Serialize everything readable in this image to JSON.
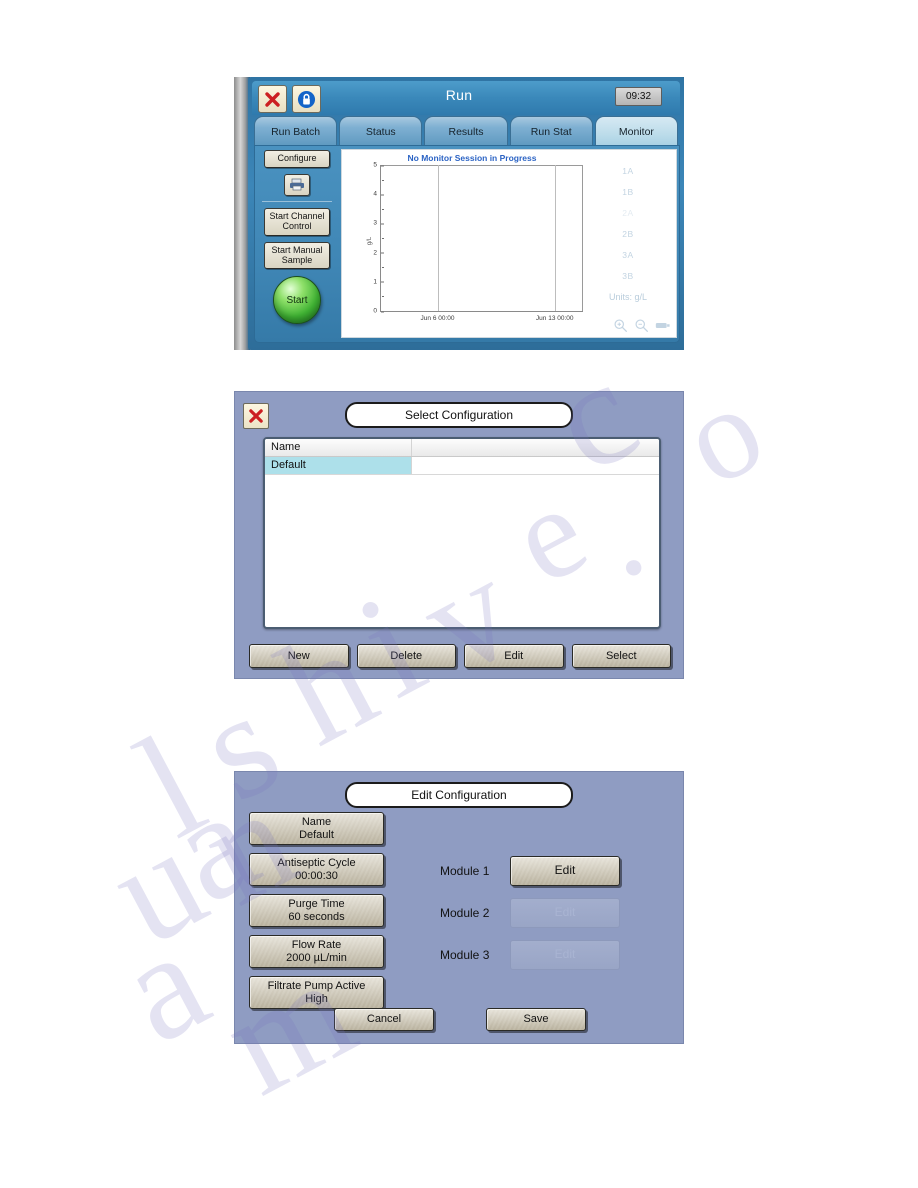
{
  "device_screen": {
    "titlebar": {
      "title": "Run",
      "clock": "09:32",
      "close_icon": "close-x-icon",
      "lock_icon": "lock-icon"
    },
    "tabs": [
      {
        "label": "Run Batch",
        "active": false
      },
      {
        "label": "Status",
        "active": false
      },
      {
        "label": "Results",
        "active": false
      },
      {
        "label": "Run Stat",
        "active": false
      },
      {
        "label": "Monitor",
        "active": true
      }
    ],
    "sidebar": {
      "configure_label": "Configure",
      "print_icon": "printer-icon",
      "start_channel_control_label": "Start Channel Control",
      "start_manual_sample_label": "Start Manual Sample",
      "start_label": "Start"
    },
    "chart_tools": {
      "zoom_in_icon": "zoom-in-icon",
      "zoom_out_icon": "zoom-out-icon",
      "pan_icon": "pan-icon"
    }
  },
  "chart_data": {
    "type": "line",
    "title": "No Monitor Session in Progress",
    "xlabel": "",
    "ylabel": "g/L",
    "ylim": [
      0,
      5
    ],
    "yticks": [
      0,
      1,
      2,
      3,
      4,
      5
    ],
    "yticks_minor": [
      0.5,
      1.5,
      2.5,
      3.5,
      4.5
    ],
    "x": [
      "Jun 6 00:00",
      "Jun 13 00:00"
    ],
    "xticks": [
      "Jun 6 00:00",
      "Jun 13 00:00"
    ],
    "series": [
      {
        "name": "1A",
        "values": []
      },
      {
        "name": "1B",
        "values": []
      },
      {
        "name": "2A",
        "values": []
      },
      {
        "name": "2B",
        "values": []
      },
      {
        "name": "3A",
        "values": []
      },
      {
        "name": "3B",
        "values": []
      }
    ],
    "legend": [
      "1A",
      "1B",
      "2A",
      "2B",
      "3A",
      "3B"
    ],
    "legend_position": "right",
    "units_label": "Units: g/L",
    "grid": false,
    "title_color": "#2b63c4"
  },
  "select_configuration": {
    "title": "Select Configuration",
    "close_icon": "close-x-icon",
    "table": {
      "headers": [
        "Name",
        ""
      ],
      "rows": [
        {
          "name": "Default",
          "selected": true
        }
      ]
    },
    "buttons": [
      "New",
      "Delete",
      "Edit",
      "Select"
    ]
  },
  "edit_configuration": {
    "title": "Edit Configuration",
    "settings": [
      {
        "label": "Name",
        "value": "Default"
      },
      {
        "label": "Antiseptic Cycle",
        "value": "00:00:30"
      },
      {
        "label": "Purge Time",
        "value": "60 seconds"
      },
      {
        "label": "Flow Rate",
        "value": "2000 µL/min"
      },
      {
        "label": "Filtrate Pump Active",
        "value": "High"
      }
    ],
    "modules": [
      {
        "label": "Module 1",
        "button": "Edit",
        "enabled": true
      },
      {
        "label": "Module 2",
        "button": "Edit",
        "enabled": false
      },
      {
        "label": "Module 3",
        "button": "Edit",
        "enabled": false
      }
    ],
    "cancel_label": "Cancel",
    "save_label": "Save"
  },
  "watermark": {
    "text": "manualshive.com"
  }
}
